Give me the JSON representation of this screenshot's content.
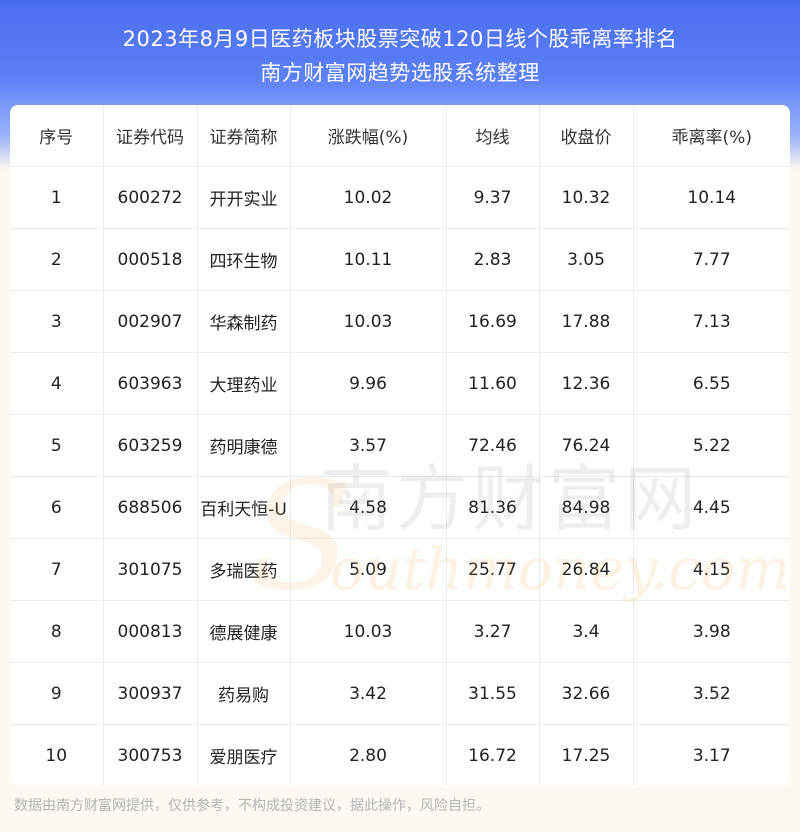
{
  "header": {
    "title_line1": "2023年8月9日医药板块股票突破120日线个股乖离率排名",
    "title_line2": "南方财富网趋势选股系统整理"
  },
  "table": {
    "columns": [
      "序号",
      "证券代码",
      "证券简称",
      "涨跌幅(%)",
      "均线",
      "收盘价",
      "乖离率(%)"
    ],
    "rows": [
      [
        "1",
        "600272",
        "开开实业",
        "10.02",
        "9.37",
        "10.32",
        "10.14"
      ],
      [
        "2",
        "000518",
        "四环生物",
        "10.11",
        "2.83",
        "3.05",
        "7.77"
      ],
      [
        "3",
        "002907",
        "华森制药",
        "10.03",
        "16.69",
        "17.88",
        "7.13"
      ],
      [
        "4",
        "603963",
        "大理药业",
        "9.96",
        "11.60",
        "12.36",
        "6.55"
      ],
      [
        "5",
        "603259",
        "药明康德",
        "3.57",
        "72.46",
        "76.24",
        "5.22"
      ],
      [
        "6",
        "688506",
        "百利天恒-U",
        "4.58",
        "81.36",
        "84.98",
        "4.45"
      ],
      [
        "7",
        "301075",
        "多瑞医药",
        "5.09",
        "25.77",
        "26.84",
        "4.15"
      ],
      [
        "8",
        "000813",
        "德展健康",
        "10.03",
        "3.27",
        "3.4",
        "3.98"
      ],
      [
        "9",
        "300937",
        "药易购",
        "3.42",
        "31.55",
        "32.66",
        "3.52"
      ],
      [
        "10",
        "300753",
        "爱朋医疗",
        "2.80",
        "16.72",
        "17.25",
        "3.17"
      ]
    ]
  },
  "watermark": {
    "cn": "南方财富网",
    "en": "outhmoney.com",
    "letter": "S"
  },
  "footer": {
    "disclaimer": "数据由南方财富网提供，仅供参考，不构成投资建议，据此操作，风险自担。"
  }
}
